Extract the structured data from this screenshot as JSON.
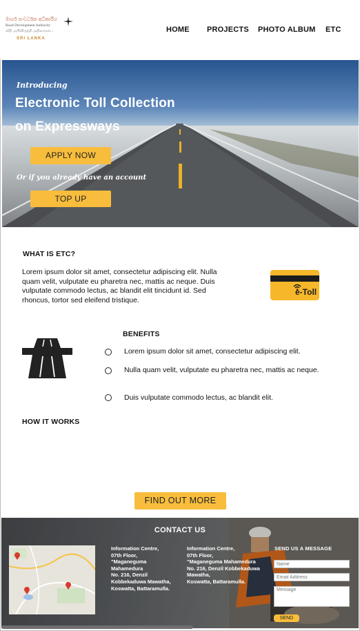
{
  "logo": {
    "line1": "මාර්ග සංවර්ධන අධිකාරිය",
    "line2": "Road Development Authority",
    "line3": "வீதி அபிவிருத்தி அதிகாரசபை",
    "line4": "SRI LANKA"
  },
  "nav": {
    "items": [
      "HOME",
      "PROJECTS",
      "PHOTO ALBUM",
      "ETC"
    ]
  },
  "hero": {
    "intro": "Introducing",
    "title_line1": "Electronic Toll Collection",
    "title_line2": "on Expressways",
    "apply_label": "APPLY NOW",
    "or_text": "Or if you already have an account",
    "topup_label": "TOP UP"
  },
  "what_is": {
    "heading": "WHAT IS ETC?",
    "body": "Lorem ipsum dolor sit amet, consectetur adipiscing elit. Nulla quam velit, vulputate eu pharetra nec, mattis ac neque. Duis vulputate commodo lectus, ac blandit elit tincidunt id. Sed rhoncus, tortor sed eleifend tristique.",
    "card_text": "e-Toll"
  },
  "benefits": {
    "heading": "BENEFITS",
    "items": [
      "Lorem ipsum dolor sit amet, consectetur adipiscing elit.",
      "Nulla quam velit, vulputate eu pharetra nec, mattis ac neque.",
      "Duis vulputate commodo lectus, ac blandit elit."
    ]
  },
  "how_it_works": {
    "heading": "HOW IT WORKS",
    "button_label": "FIND OUT MORE"
  },
  "footer": {
    "heading": "CONTACT US",
    "address1": [
      "Information Centre,",
      "07th Floor,",
      "\"Maganeguma",
      "Mahamedura",
      "No. 216, Denzil",
      "Kobbekaduwa Mawatha,",
      "Koswatta, Battaramulla."
    ],
    "address2": [
      "Information Centre,",
      "07th Floor,",
      "\"Maganeguma Mahamedura",
      "No. 216, Denzil Kobbekaduwa",
      "Mawatha,",
      "Koswatta, Battaramulla."
    ],
    "message_heading": "SEND US A MESSAGE",
    "name_placeholder": "Name",
    "email_placeholder": "Email Address",
    "message_placeholder": "Message",
    "send_label": "SEND"
  },
  "colors": {
    "accent": "#f8bd3c",
    "footer_bg": "#5a5d60"
  }
}
